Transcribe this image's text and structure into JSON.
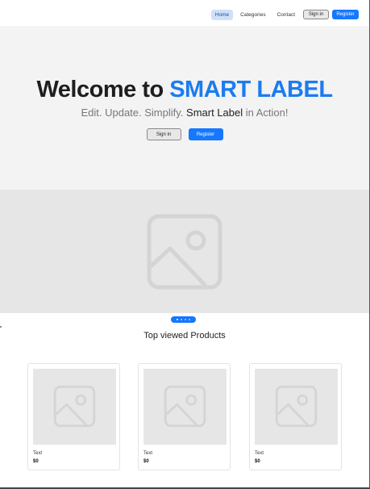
{
  "nav": {
    "links": [
      "Home",
      "Categories",
      "Contact"
    ],
    "active": "Home",
    "signin_label": "Sign in",
    "register_label": "Register"
  },
  "hero": {
    "title_prefix": "Welcome to ",
    "title_brand": "SMART LABEL",
    "subtitle_prefix": "Edit. Update. Simplify. ",
    "subtitle_strong": "Smart Label",
    "subtitle_suffix": " in Action!",
    "signin_label": "Sign in",
    "register_label": "Register"
  },
  "banner": {
    "icon": "image-placeholder-icon",
    "slides": 4,
    "active_slide": 1
  },
  "products": {
    "title": "Top viewed Products",
    "items": [
      {
        "name": "Text",
        "price": "$0"
      },
      {
        "name": "Text",
        "price": "$0"
      },
      {
        "name": "Text",
        "price": "$0"
      }
    ]
  },
  "colors": {
    "accent": "#1677ff",
    "brand": "#1b7cf0",
    "hero_bg": "#f3f3f3",
    "placeholder_bg": "#e6e6e6"
  }
}
